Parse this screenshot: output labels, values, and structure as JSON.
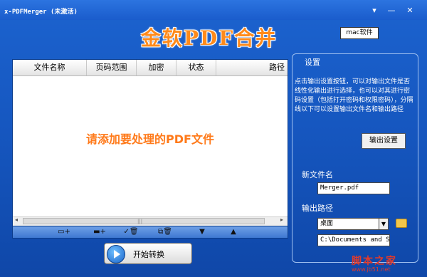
{
  "window": {
    "title": "x-PDFMerger (未激活)",
    "minimize": "▾",
    "restore": "—",
    "close": "✕"
  },
  "banner": {
    "title": "金软PDF合并",
    "mac_link": "mac软件"
  },
  "list": {
    "columns": [
      "文件名称",
      "页码范围",
      "加密",
      "状态",
      "路径"
    ],
    "hint": "请添加要处理的PDF文件",
    "scroll_grip": "|||",
    "scroll_left": "◂",
    "scroll_right": "▸"
  },
  "toolbar": {
    "add_file": "▭+",
    "add_folder": "▬+",
    "check_delete": "✓🗑",
    "copy_delete": "⧉🗑",
    "move_down": "▼",
    "move_up": "▲"
  },
  "start_button": {
    "label": "开始转换"
  },
  "settings": {
    "label": "设置",
    "description": "点击输出设置按钮，可以对输出文件是否线性化输出进行选择，也可以对其进行密码设置（包括打开密码和权限密码），分隔线以下可以设置输出文件名和输出路径",
    "output_button": "输出设置",
    "new_filename_label": "新文件名",
    "new_filename_value": "Merger.pdf",
    "output_path_label": "输出路径",
    "output_path_select": "桌面",
    "output_path_value": "C:\\Documents and Se"
  },
  "watermark": {
    "text": "脚本之家",
    "url": "www.jb51.net"
  },
  "icons": [
    "minimize-icon",
    "restore-icon",
    "close-icon",
    "play-icon",
    "folder-icon",
    "dropdown-arrow-icon"
  ]
}
